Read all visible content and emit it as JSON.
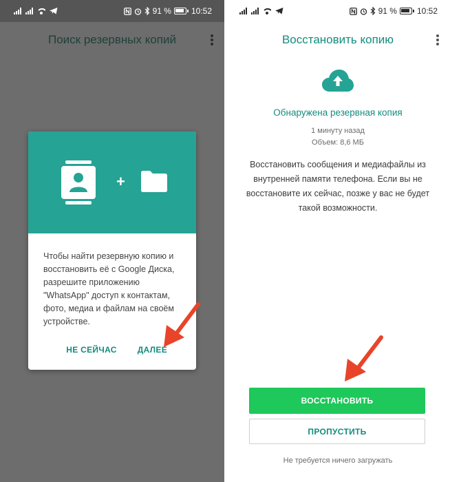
{
  "status": {
    "battery": "91 %",
    "time": "10:52",
    "icons": [
      "signal-icon",
      "wifi-icon",
      "telegram-icon",
      "nfc-icon",
      "alarm-icon",
      "bluetooth-icon",
      "battery-icon"
    ]
  },
  "left_screen": {
    "title": "Поиск резервных копий",
    "dialog": {
      "body": "Чтобы найти резервную копию и восстановить её с Google Диска, разрешите приложению \"WhatsApp\" доступ к контактам, фото, медиа и файлам на своём устройстве.",
      "plus": "+",
      "not_now": "НЕ СЕЙЧАС",
      "next": "ДАЛЕЕ"
    }
  },
  "right_screen": {
    "title": "Восстановить копию",
    "found_title": "Обнаружена резервная копия",
    "time_ago": "1 минуту назад",
    "size": "Объем: 8,6 МБ",
    "description": "Восстановить сообщения и медиафайлы из внутренней памяти телефона. Если вы не восстановите их сейчас, позже у вас не будет такой возможности.",
    "restore_button": "ВОССТАНОВИТЬ",
    "skip_button": "ПРОПУСТИТЬ",
    "footnote": "Не требуется ничего загружать"
  },
  "colors": {
    "accent": "#128c7e",
    "header_teal": "#25a394",
    "restore_green": "#1ec85a",
    "annotation_arrow": "#e8442a",
    "overlay_grey": "#6d6d6d"
  }
}
